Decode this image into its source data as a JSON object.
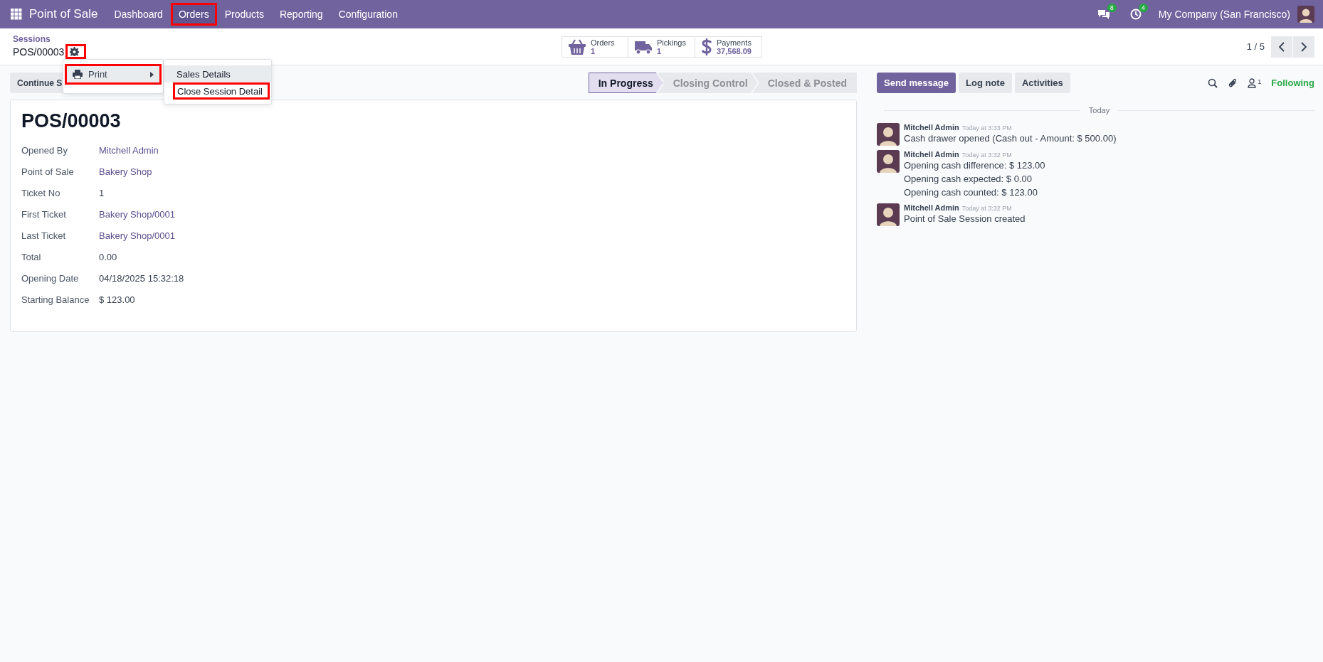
{
  "navbar": {
    "app_name": "Point of Sale",
    "menu": [
      {
        "label": "Dashboard",
        "highlighted": false
      },
      {
        "label": "Orders",
        "highlighted": true
      },
      {
        "label": "Products",
        "highlighted": false
      },
      {
        "label": "Reporting",
        "highlighted": false
      },
      {
        "label": "Configuration",
        "highlighted": false
      }
    ],
    "chat_badge": "8",
    "activity_badge": "4",
    "company": "My Company (San Francisco)"
  },
  "breadcrumb": {
    "parent": "Sessions",
    "current": "POS/00003",
    "gear_highlighted": true
  },
  "smart_buttons": [
    {
      "kind": "basket",
      "label": "Orders",
      "value": "1"
    },
    {
      "kind": "truck",
      "label": "Pickings",
      "value": "1"
    },
    {
      "kind": "dollar",
      "label": "Payments",
      "value": "37,568.09"
    }
  ],
  "pager": {
    "text": "1 / 5"
  },
  "action_buttons": [
    {
      "label": "Continue S"
    }
  ],
  "statusbar": [
    {
      "label": "In Progress",
      "selected": true
    },
    {
      "label": "Closing Control",
      "selected": false
    },
    {
      "label": "Closed & Posted",
      "selected": false
    }
  ],
  "form": {
    "title": "POS/00003",
    "fields": [
      {
        "label": "Opened By",
        "value": "Mitchell Admin",
        "link": true
      },
      {
        "label": "Point of Sale",
        "value": "Bakery Shop",
        "link": true
      },
      {
        "label": "Ticket No",
        "value": "1",
        "link": false
      },
      {
        "label": "First Ticket",
        "value": "Bakery Shop/0001",
        "link": true
      },
      {
        "label": "Last Ticket",
        "value": "Bakery Shop/0001",
        "link": true
      },
      {
        "label": "Total",
        "value": "0.00",
        "link": false
      },
      {
        "label": "Opening Date",
        "value": "04/18/2025 15:32:18",
        "link": false
      },
      {
        "label": "Starting Balance",
        "value": "$ 123.00",
        "link": false
      }
    ]
  },
  "chatter": {
    "buttons": [
      {
        "label": "Send message",
        "primary": true
      },
      {
        "label": "Log note",
        "primary": false
      },
      {
        "label": "Activities",
        "primary": false
      }
    ],
    "followers_count": "1",
    "follow_label": "Following",
    "date_separator": "Today",
    "messages": [
      {
        "author": "Mitchell Admin",
        "time": "Today at 3:33 PM",
        "lines": [
          "Cash drawer opened (Cash out - Amount: $ 500.00)"
        ]
      },
      {
        "author": "Mitchell Admin",
        "time": "Today at 3:32 PM",
        "lines": [
          "Opening cash difference: $ 123.00",
          "Opening cash expected: $ 0.00",
          "Opening cash counted: $ 123.00"
        ]
      },
      {
        "author": "Mitchell Admin",
        "time": "Today at 3:32 PM",
        "lines": [
          "Point of Sale Session created"
        ]
      }
    ]
  },
  "dropdown": {
    "items": [
      {
        "label": "Print",
        "highlighted": true
      }
    ],
    "submenu": [
      {
        "label": "Sales Details",
        "active": true,
        "highlighted": false
      },
      {
        "label": "Close Session Detail",
        "active": false,
        "highlighted": true
      }
    ]
  }
}
